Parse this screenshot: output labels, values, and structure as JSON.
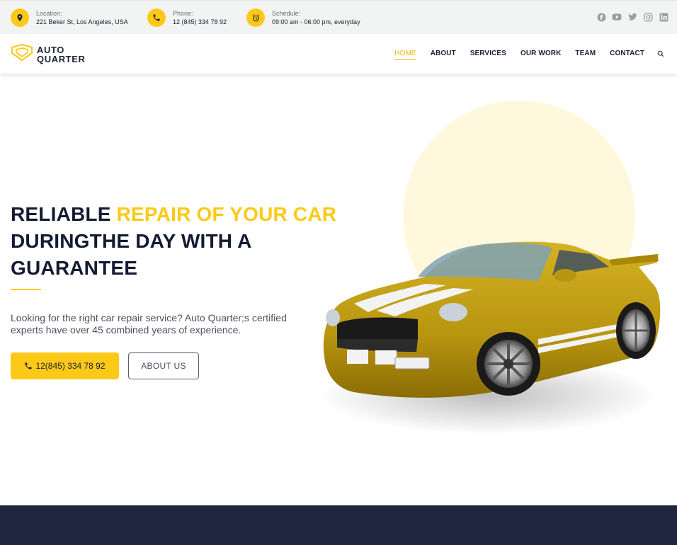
{
  "topbar": {
    "location": {
      "label": "Location:",
      "value": "221 Beker St, Los Angeles, USA",
      "icon": "map-pin-icon"
    },
    "phone": {
      "label": "Phone:",
      "value": "12 (845) 334 78 92",
      "icon": "phone-icon"
    },
    "schedule": {
      "label": "Schedule:",
      "value": "09:00 am - 06:00 pm, everyday",
      "icon": "alarm-clock-icon"
    },
    "socials": [
      "facebook-icon",
      "youtube-icon",
      "twitter-icon",
      "instagram-icon",
      "linkedin-icon"
    ]
  },
  "brand": {
    "line1": "AUTO",
    "line2": "QUARTER",
    "icon": "logo-mark-icon"
  },
  "nav": {
    "items": [
      "HOME",
      "ABOUT",
      "SERVICES",
      "OUR WORK",
      "TEAM",
      "CONTACT"
    ],
    "active": "HOME",
    "search_icon": "search-icon"
  },
  "hero": {
    "headline_part1": "RELIABLE ",
    "headline_highlight": "REPAIR OF YOUR CAR",
    "headline_part2": "DURINGTHE DAY WITH A GUARANTEE",
    "lead": "Looking for the right car repair service? Auto Quarter;s certified experts have over 45 combined years of experience.",
    "call_button": "12(845) 334 78 92",
    "about_button": "ABOUT US",
    "image": "yellow-sports-car"
  },
  "colors": {
    "accent": "#fdc918",
    "dark": "#1f2640",
    "topbar_bg": "#f2f3f3",
    "sun": "#fff8dc"
  }
}
